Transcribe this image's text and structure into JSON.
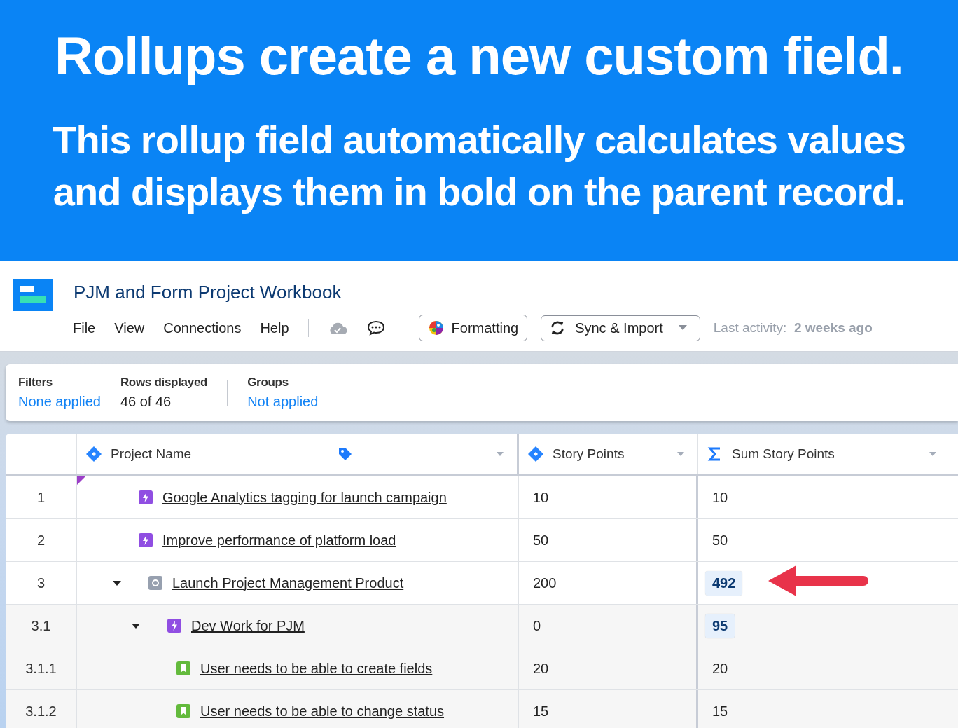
{
  "banner": {
    "headline": "Rollups create a new custom field.",
    "subhead": "This rollup field automatically calculates values and displays them in bold on the parent record."
  },
  "header": {
    "title": "PJM and Form Project Workbook",
    "menu": [
      "File",
      "View",
      "Connections",
      "Help"
    ],
    "formatting_button": "Formatting",
    "sync_button": "Sync & Import",
    "activity_label": "Last activity:",
    "activity_value": "2 weeks ago"
  },
  "summary": [
    {
      "label": "Filters",
      "value": "None applied",
      "kind": "link"
    },
    {
      "label": "Rows displayed",
      "value": "46 of 46",
      "kind": "plain"
    },
    {
      "label": "Groups",
      "value": "Not applied",
      "kind": "link"
    }
  ],
  "table": {
    "columns": [
      {
        "label": "Project Name",
        "kind": "jira",
        "tag": true
      },
      {
        "label": "Story Points",
        "kind": "jira"
      },
      {
        "label": "Sum Story Points",
        "kind": "sum"
      }
    ],
    "rows": [
      {
        "number": "1",
        "name": "Google Analytics tagging for launch campaign",
        "kind": "epic",
        "marked": true,
        "story_points": "10",
        "sum": "10",
        "rollup": false
      },
      {
        "number": "2",
        "name": "Improve performance of platform load",
        "kind": "epic",
        "story_points": "50",
        "sum": "50",
        "rollup": false
      },
      {
        "number": "3",
        "name": "Launch Project Management Product",
        "kind": "initiative",
        "expanded": true,
        "story_points": "200",
        "sum": "492",
        "rollup": true,
        "pointer": true,
        "children": [
          {
            "number": "3.1",
            "name": "Dev Work for PJM",
            "kind": "epic",
            "expanded": true,
            "story_points": "0",
            "sum": "95",
            "rollup": true,
            "children": [
              {
                "number": "3.1.1",
                "name": "User needs to be able to create fields",
                "kind": "story",
                "story_points": "20",
                "sum": "20",
                "rollup": false
              },
              {
                "number": "3.1.2",
                "name": "User needs to be able to change status",
                "kind": "story",
                "story_points": "15",
                "sum": "15",
                "rollup": false
              }
            ]
          }
        ]
      }
    ]
  }
}
